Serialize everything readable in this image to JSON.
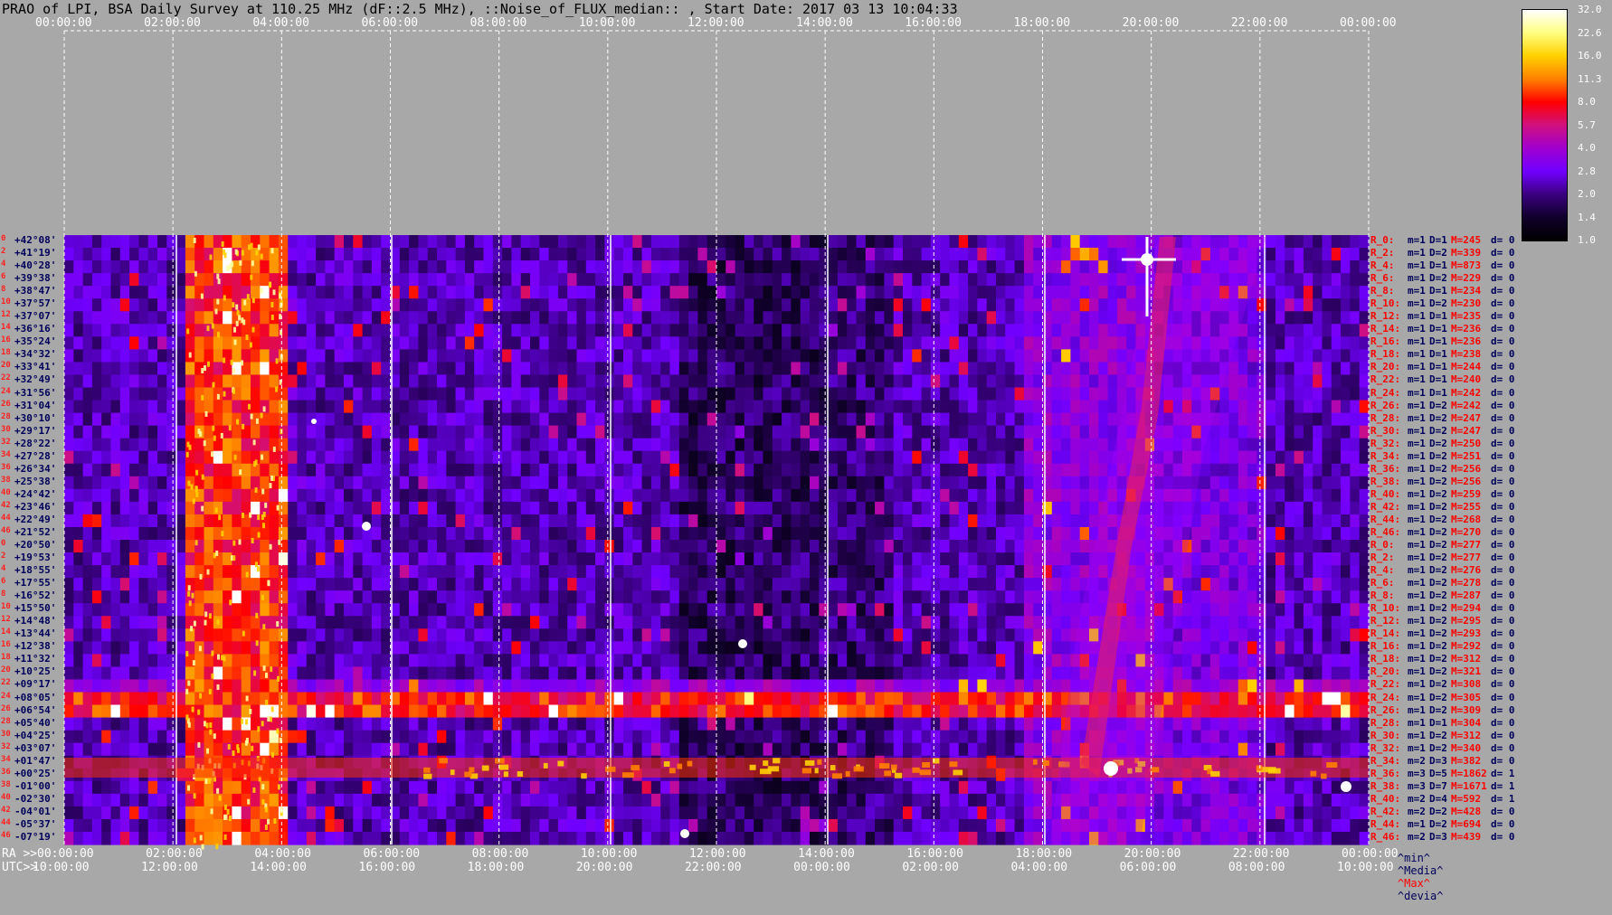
{
  "title": "PRAO of LPI, BSA Daily Survey at 110.25 MHz (dF::2.5 MHz), ::Noise_of_FLUX_median:: , Start Date: 2017 03 13 10:04:33",
  "axes": {
    "ra_prefix": "RA >>",
    "utc_prefix": "UTC>>",
    "top_ticks": [
      "00:00:00",
      "02:00:00",
      "04:00:00",
      "06:00:00",
      "08:00:00",
      "10:00:00",
      "12:00:00",
      "14:00:00",
      "16:00:00",
      "18:00:00",
      "20:00:00",
      "22:00:00",
      "00:00:00"
    ],
    "ra_ticks": [
      "00:00:00",
      "02:00:00",
      "04:00:00",
      "06:00:00",
      "08:00:00",
      "10:00:00",
      "12:00:00",
      "14:00:00",
      "16:00:00",
      "18:00:00",
      "20:00:00",
      "22:00:00",
      "00:00:00"
    ],
    "utc_ticks": [
      "10:00:00",
      "12:00:00",
      "14:00:00",
      "16:00:00",
      "18:00:00",
      "20:00:00",
      "22:00:00",
      "00:00:00",
      "02:00:00",
      "04:00:00",
      "06:00:00",
      "08:00:00",
      "10:00:00"
    ]
  },
  "colorbar": {
    "ticks": [
      "32.0",
      "22.6",
      "16.0",
      "11.3",
      "8.0",
      "5.7",
      "4.0",
      "2.8",
      "2.0",
      "1.4",
      "1.0"
    ],
    "colors": [
      "#ffffff",
      "#ffff80",
      "#ffd000",
      "#ff8000",
      "#ff0000",
      "#d0107f",
      "#a000d0",
      "#7000ff",
      "#3a0080",
      "#10002a",
      "#000000"
    ]
  },
  "legend": {
    "min": "^min^",
    "median": "^Media^",
    "max": "^Max^",
    "devia": "^devia^"
  },
  "chart_data": {
    "type": "heatmap",
    "title": "PRAO of LPI, BSA Daily Survey at 110.25 MHz (dF::2.5 MHz), ::Noise_of_FLUX_median:: , Start Date: 2017 03 13 10:04:33",
    "x_axis_top": "RA",
    "x_axis_bottom": "UTC",
    "row_numbers": [
      "0",
      "2",
      "4",
      "6",
      "8",
      "10",
      "12",
      "14",
      "16",
      "18",
      "20",
      "22",
      "24",
      "26",
      "28",
      "30",
      "32",
      "34",
      "36",
      "38",
      "40",
      "42",
      "44",
      "46",
      "0",
      "2",
      "4",
      "6",
      "8",
      "10",
      "12",
      "14",
      "16",
      "18",
      "20",
      "22",
      "24",
      "26",
      "28",
      "30",
      "32",
      "34",
      "36",
      "38",
      "40",
      "42",
      "44",
      "46"
    ],
    "declinations": [
      "+42°08'",
      "+41°19'",
      "+40°28'",
      "+39°38'",
      "+38°47'",
      "+37°57'",
      "+37°07'",
      "+36°16'",
      "+35°24'",
      "+34°32'",
      "+33°41'",
      "+32°49'",
      "+31°56'",
      "+31°04'",
      "+30°10'",
      "+29°17'",
      "+28°22'",
      "+27°28'",
      "+26°34'",
      "+25°38'",
      "+24°42'",
      "+23°46'",
      "+22°49'",
      "+21°52'",
      "+20°50'",
      "+19°53'",
      "+18°55'",
      "+17°55'",
      "+16°52'",
      "+15°50'",
      "+14°48'",
      "+13°44'",
      "+12°38'",
      "+11°32'",
      "+10°25'",
      "+09°17'",
      "+08°05'",
      "+06°54'",
      "+05°40'",
      "+04°25'",
      "+03°07'",
      "+01°47'",
      "+00°25'",
      "-01°00'",
      "-02°30'",
      "-04°01'",
      "-05°37'",
      "-07°19'"
    ],
    "right_rows": [
      {
        "r": "R_0:",
        "m": "m=1",
        "d": "D=1",
        "M": "M=245",
        "dv": "d= 0"
      },
      {
        "r": "R_2:",
        "m": "m=1",
        "d": "D=2",
        "M": "M=339",
        "dv": "d= 0"
      },
      {
        "r": "R_4:",
        "m": "m=1",
        "d": "D=1",
        "M": "M=873",
        "dv": "d= 0"
      },
      {
        "r": "R_6:",
        "m": "m=1",
        "d": "D=2",
        "M": "M=229",
        "dv": "d= 0"
      },
      {
        "r": "R_8:",
        "m": "m=1",
        "d": "D=1",
        "M": "M=234",
        "dv": "d= 0"
      },
      {
        "r": "R_10:",
        "m": "m=1",
        "d": "D=2",
        "M": "M=230",
        "dv": "d= 0"
      },
      {
        "r": "R_12:",
        "m": "m=1",
        "d": "D=1",
        "M": "M=235",
        "dv": "d= 0"
      },
      {
        "r": "R_14:",
        "m": "m=1",
        "d": "D=1",
        "M": "M=236",
        "dv": "d= 0"
      },
      {
        "r": "R_16:",
        "m": "m=1",
        "d": "D=1",
        "M": "M=236",
        "dv": "d= 0"
      },
      {
        "r": "R_18:",
        "m": "m=1",
        "d": "D=1",
        "M": "M=238",
        "dv": "d= 0"
      },
      {
        "r": "R_20:",
        "m": "m=1",
        "d": "D=1",
        "M": "M=244",
        "dv": "d= 0"
      },
      {
        "r": "R_22:",
        "m": "m=1",
        "d": "D=1",
        "M": "M=240",
        "dv": "d= 0"
      },
      {
        "r": "R_24:",
        "m": "m=1",
        "d": "D=1",
        "M": "M=242",
        "dv": "d= 0"
      },
      {
        "r": "R_26:",
        "m": "m=1",
        "d": "D=2",
        "M": "M=242",
        "dv": "d= 0"
      },
      {
        "r": "R_28:",
        "m": "m=1",
        "d": "D=2",
        "M": "M=247",
        "dv": "d= 0"
      },
      {
        "r": "R_30:",
        "m": "m=1",
        "d": "D=2",
        "M": "M=247",
        "dv": "d= 0"
      },
      {
        "r": "R_32:",
        "m": "m=1",
        "d": "D=2",
        "M": "M=250",
        "dv": "d= 0"
      },
      {
        "r": "R_34:",
        "m": "m=1",
        "d": "D=2",
        "M": "M=251",
        "dv": "d= 0"
      },
      {
        "r": "R_36:",
        "m": "m=1",
        "d": "D=2",
        "M": "M=256",
        "dv": "d= 0"
      },
      {
        "r": "R_38:",
        "m": "m=1",
        "d": "D=2",
        "M": "M=256",
        "dv": "d= 0"
      },
      {
        "r": "R_40:",
        "m": "m=1",
        "d": "D=2",
        "M": "M=259",
        "dv": "d= 0"
      },
      {
        "r": "R_42:",
        "m": "m=1",
        "d": "D=2",
        "M": "M=255",
        "dv": "d= 0"
      },
      {
        "r": "R_44:",
        "m": "m=1",
        "d": "D=2",
        "M": "M=268",
        "dv": "d= 0"
      },
      {
        "r": "R_46:",
        "m": "m=1",
        "d": "D=2",
        "M": "M=270",
        "dv": "d= 0"
      },
      {
        "r": "R_0:",
        "m": "m=1",
        "d": "D=2",
        "M": "M=277",
        "dv": "d= 0"
      },
      {
        "r": "R_2:",
        "m": "m=1",
        "d": "D=2",
        "M": "M=277",
        "dv": "d= 0"
      },
      {
        "r": "R_4:",
        "m": "m=1",
        "d": "D=2",
        "M": "M=276",
        "dv": "d= 0"
      },
      {
        "r": "R_6:",
        "m": "m=1",
        "d": "D=2",
        "M": "M=278",
        "dv": "d= 0"
      },
      {
        "r": "R_8:",
        "m": "m=1",
        "d": "D=2",
        "M": "M=287",
        "dv": "d= 0"
      },
      {
        "r": "R_10:",
        "m": "m=1",
        "d": "D=2",
        "M": "M=294",
        "dv": "d= 0"
      },
      {
        "r": "R_12:",
        "m": "m=1",
        "d": "D=2",
        "M": "M=295",
        "dv": "d= 0"
      },
      {
        "r": "R_14:",
        "m": "m=1",
        "d": "D=2",
        "M": "M=293",
        "dv": "d= 0"
      },
      {
        "r": "R_16:",
        "m": "m=1",
        "d": "D=2",
        "M": "M=292",
        "dv": "d= 0"
      },
      {
        "r": "R_18:",
        "m": "m=1",
        "d": "D=2",
        "M": "M=312",
        "dv": "d= 0"
      },
      {
        "r": "R_20:",
        "m": "m=1",
        "d": "D=2",
        "M": "M=321",
        "dv": "d= 0"
      },
      {
        "r": "R_22:",
        "m": "m=1",
        "d": "D=2",
        "M": "M=308",
        "dv": "d= 0"
      },
      {
        "r": "R_24:",
        "m": "m=1",
        "d": "D=2",
        "M": "M=305",
        "dv": "d= 0"
      },
      {
        "r": "R_26:",
        "m": "m=1",
        "d": "D=2",
        "M": "M=309",
        "dv": "d= 0"
      },
      {
        "r": "R_28:",
        "m": "m=1",
        "d": "D=1",
        "M": "M=304",
        "dv": "d= 0"
      },
      {
        "r": "R_30:",
        "m": "m=1",
        "d": "D=2",
        "M": "M=312",
        "dv": "d= 0"
      },
      {
        "r": "R_32:",
        "m": "m=1",
        "d": "D=2",
        "M": "M=340",
        "dv": "d= 0"
      },
      {
        "r": "R_34:",
        "m": "m=2",
        "d": "D=3",
        "M": "M=382",
        "dv": "d= 0"
      },
      {
        "r": "R_36:",
        "m": "m=3",
        "d": "D=5",
        "M": "M=1862",
        "dv": "d= 1"
      },
      {
        "r": "R_38:",
        "m": "m=3",
        "d": "D=7",
        "M": "M=1671",
        "dv": "d= 1"
      },
      {
        "r": "R_40:",
        "m": "m=2",
        "d": "D=4",
        "M": "M=592",
        "dv": "d= 1"
      },
      {
        "r": "R_42:",
        "m": "m=2",
        "d": "D=2",
        "M": "M=428",
        "dv": "d= 0"
      },
      {
        "r": "R_44:",
        "m": "m=1",
        "d": "D=2",
        "M": "M=694",
        "dv": "d= 0"
      },
      {
        "r": "R_46:",
        "m": "m=2",
        "d": "D=3",
        "M": "M=439",
        "dv": "d= 0"
      }
    ],
    "colorbar_range": [
      1.0,
      32.0
    ],
    "colorbar_scale": "log",
    "grid": true
  }
}
